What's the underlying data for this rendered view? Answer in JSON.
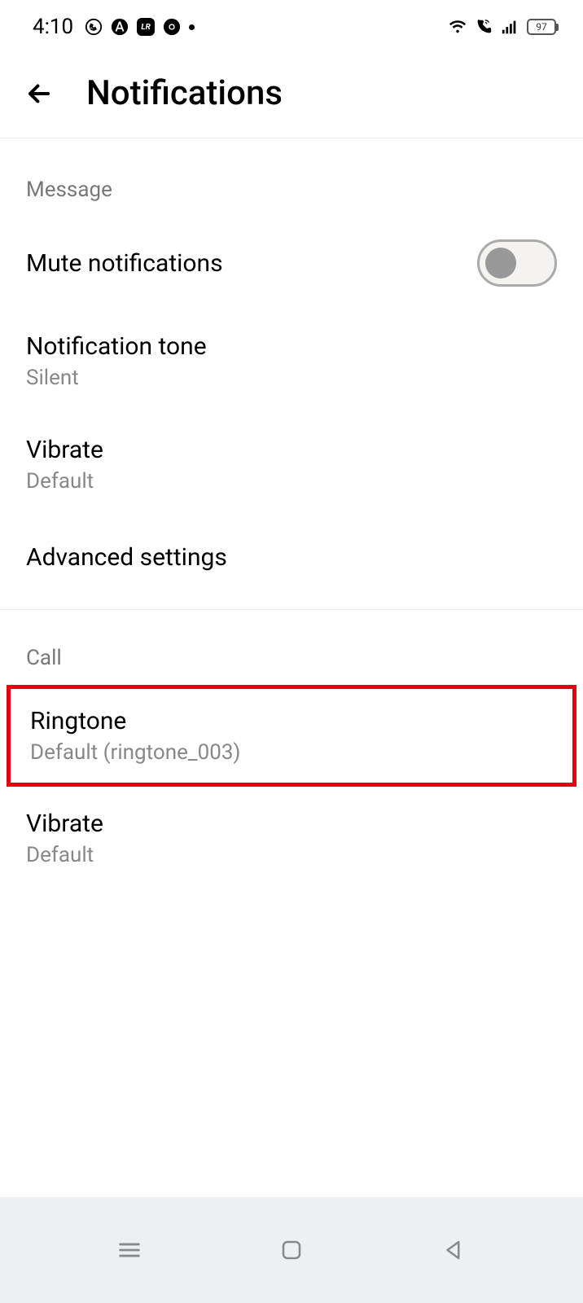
{
  "status": {
    "time": "4:10",
    "battery": "97"
  },
  "header": {
    "title": "Notifications"
  },
  "sections": {
    "message": {
      "header": "Message",
      "mute": {
        "title": "Mute notifications"
      },
      "tone": {
        "title": "Notification tone",
        "value": "Silent"
      },
      "vibrate": {
        "title": "Vibrate",
        "value": "Default"
      },
      "advanced": {
        "title": "Advanced settings"
      }
    },
    "call": {
      "header": "Call",
      "ringtone": {
        "title": "Ringtone",
        "value": "Default (ringtone_003)"
      },
      "vibrate": {
        "title": "Vibrate",
        "value": "Default"
      }
    }
  }
}
